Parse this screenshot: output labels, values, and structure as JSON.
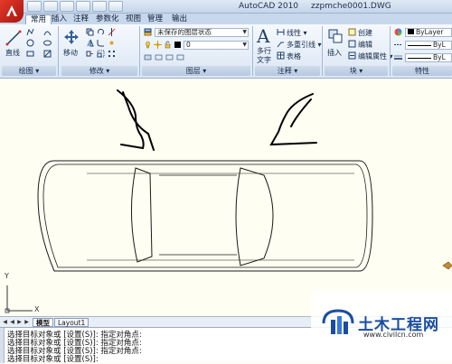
{
  "window": {
    "app_name": "AutoCAD 2010",
    "file_name": "zzpmche0001.DWG"
  },
  "tabs": [
    "常用",
    "插入",
    "注释",
    "参数化",
    "视图",
    "管理",
    "输出"
  ],
  "ribbon": {
    "draw": {
      "line_label": "直线",
      "panel_title": "绘图 ▾"
    },
    "modify": {
      "move_label": "移动",
      "panel_title": "修改 ▾"
    },
    "layers": {
      "layer_state": "未保存的图层状态",
      "current_layer": "0",
      "panel_title": "图层 ▾"
    },
    "annotation": {
      "multiline_text": "多行",
      "multiline_text_2": "文字",
      "linear_dim": "线性 ▾",
      "multileader": "多重引线 ▾",
      "table": "表格",
      "panel_title": "注释 ▾"
    },
    "block": {
      "insert_label": "插入",
      "create_label": "创建",
      "edit_label": "编辑",
      "edit_attr_label": "编辑属性 ▾",
      "panel_title": "块 ▾"
    },
    "properties": {
      "color": "ByLayer",
      "linetype": "ByL",
      "lineweight": "ByL",
      "panel_title": "特性"
    }
  },
  "ucs": {
    "y_axis": "Y",
    "x_axis": "X"
  },
  "layout_tabs": [
    "模型",
    "Layout1"
  ],
  "command_history": [
    "选择目标对象或 [设置(S)]: 指定对角点:",
    "选择目标对象或 [设置(S)]: 指定对角点:",
    "选择目标对象或 [设置(S)]: 指定对角点:",
    "选择目标对象或 [设置(S)]:"
  ],
  "watermark": {
    "name": "土木工程网",
    "url": "www.civilcn.com"
  },
  "colors": {
    "ribbon_bg": "#dae6f4",
    "canvas_bg": "#fffef2",
    "accent": "#1a4da1"
  }
}
